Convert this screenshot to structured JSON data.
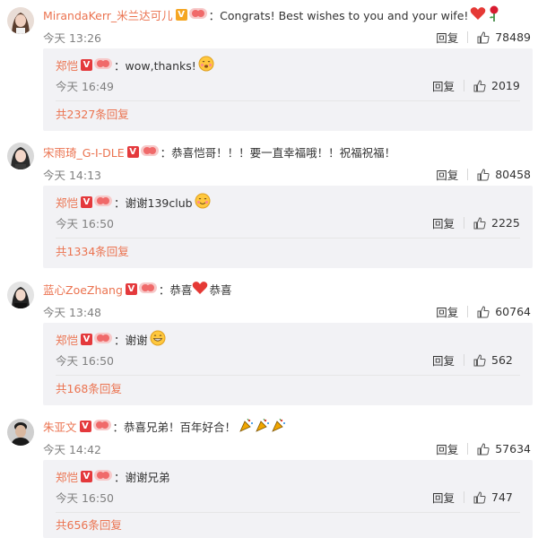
{
  "comments": [
    {
      "username": "MirandaKerr_米兰达可儿",
      "verified": "V",
      "text": "Congrats!  Best wishes to you and your wife!",
      "time": "今天 13:26",
      "reply_label": "回复",
      "likes": "78489",
      "reply": {
        "username": "郑恺",
        "verified": "V",
        "text": "wow,thanks!",
        "time": "今天 16:49",
        "reply_label": "回复",
        "likes": "2019"
      },
      "more_label": "共2327条回复"
    },
    {
      "username": "宋雨琦_G-I-DLE",
      "verified": "V",
      "text": "恭喜恺哥！！！要一直幸福哦！！祝福祝福！",
      "time": "今天 14:13",
      "reply_label": "回复",
      "likes": "80458",
      "reply": {
        "username": "郑恺",
        "verified": "V",
        "text": "谢谢139club",
        "time": "今天 16:50",
        "reply_label": "回复",
        "likes": "2225"
      },
      "more_label": "共1334条回复"
    },
    {
      "username": "蓝心ZoeZhang",
      "verified": "V",
      "text_a": "恭喜",
      "text_b": "恭喜",
      "time": "今天 13:48",
      "reply_label": "回复",
      "likes": "60764",
      "reply": {
        "username": "郑恺",
        "verified": "V",
        "text": "谢谢",
        "time": "今天 16:50",
        "reply_label": "回复",
        "likes": "562"
      },
      "more_label": "共168条回复"
    },
    {
      "username": "朱亚文",
      "verified": "V",
      "text": "恭喜兄弟！百年好合！",
      "time": "今天 14:42",
      "reply_label": "回复",
      "likes": "57634",
      "reply": {
        "username": "郑恺",
        "verified": "V",
        "text": "谢谢兄弟",
        "time": "今天 16:50",
        "reply_label": "回复",
        "likes": "747"
      },
      "more_label": "共656条回复"
    }
  ],
  "colors": {
    "username": "#eb7350",
    "vip_badge": "#f5a623",
    "verified_badge": "#e4393c",
    "reply_box_bg": "#f2f2f5"
  },
  "icons": {
    "like": "thumbs-up-icon",
    "fan_badge": "fan-badge-icon",
    "heart": "heart-emoji",
    "rose": "rose-emoji",
    "blush": "blush-emoji",
    "grin": "grin-emoji",
    "celebrate": "party-popper-emoji"
  }
}
